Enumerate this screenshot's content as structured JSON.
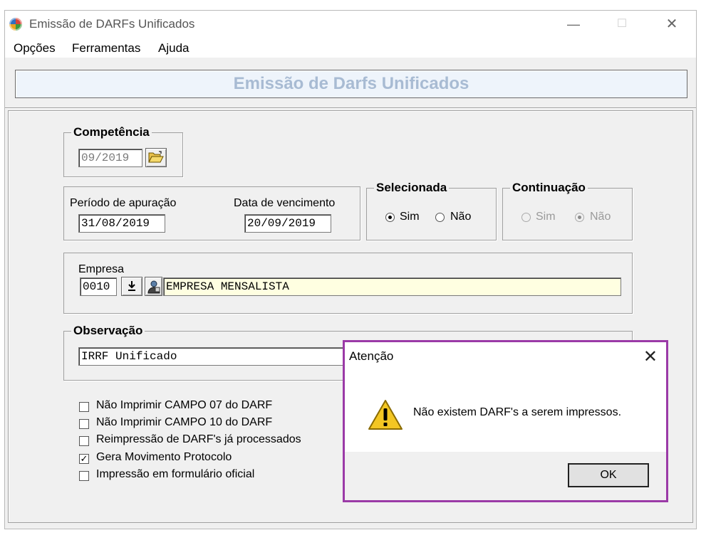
{
  "window": {
    "title": "Emissão de DARFs Unificados",
    "controls": {
      "minimize": "—",
      "maximize": "☐",
      "close": "✕"
    }
  },
  "menu": [
    "Opções",
    "Ferramentas",
    "Ajuda"
  ],
  "header": {
    "title": "Emissão de Darfs Unificados"
  },
  "competencia": {
    "label": "Competência",
    "value": "09/2019"
  },
  "periodo": {
    "apuracao_label": "Período de apuração",
    "apuracao_value": "31/08/2019",
    "vencimento_label": "Data de vencimento",
    "vencimento_value": "20/09/2019"
  },
  "selecionada": {
    "label": "Selecionada",
    "sim": "Sim",
    "nao": "Não",
    "selected": "Sim"
  },
  "continuacao": {
    "label": "Continuação",
    "sim": "Sim",
    "nao": "Não",
    "selected": "Não",
    "disabled": true
  },
  "empresa": {
    "label": "Empresa",
    "code": "0010",
    "name": "EMPRESA MENSALISTA"
  },
  "observacao": {
    "label": "Observação",
    "value": "IRRF Unificado"
  },
  "options": [
    {
      "label": "Não Imprimir CAMPO 07 do DARF",
      "checked": false
    },
    {
      "label": "Não Imprimir CAMPO 10 do DARF",
      "checked": false
    },
    {
      "label": "Reimpressão de DARF's já processados",
      "checked": false
    },
    {
      "label": "Gera Movimento Protocolo",
      "checked": true
    },
    {
      "label": "Impressão em formulário oficial",
      "checked": false
    }
  ],
  "dialog": {
    "title": "Atenção",
    "message": "Não existem DARF's a serem impressos.",
    "ok_label": "OK",
    "close": "✕"
  },
  "colors": {
    "dialog_border": "#9b3aa7",
    "header_text": "#a8bbd3",
    "warning": "#f3c623"
  }
}
